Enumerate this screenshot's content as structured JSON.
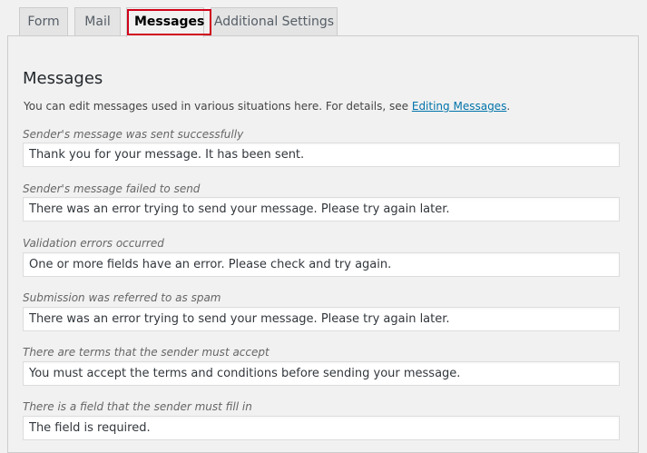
{
  "tabs": [
    {
      "label": "Form",
      "active": false
    },
    {
      "label": "Mail",
      "active": false
    },
    {
      "label": "Messages",
      "active": true
    },
    {
      "label": "Additional Settings",
      "active": false
    }
  ],
  "panel": {
    "title": "Messages",
    "intro_text": "You can edit messages used in various situations here. For details, see ",
    "intro_link": "Editing Messages",
    "intro_end": "."
  },
  "messages": [
    {
      "label": "Sender's message was sent successfully",
      "value": "Thank you for your message. It has been sent."
    },
    {
      "label": "Sender's message failed to send",
      "value": "There was an error trying to send your message. Please try again later."
    },
    {
      "label": "Validation errors occurred",
      "value": "One or more fields have an error. Please check and try again."
    },
    {
      "label": "Submission was referred to as spam",
      "value": "There was an error trying to send your message. Please try again later."
    },
    {
      "label": "There are terms that the sender must accept",
      "value": "You must accept the terms and conditions before sending your message."
    },
    {
      "label": "There is a field that the sender must fill in",
      "value": "The field is required."
    }
  ],
  "colors": {
    "active_tab_highlight": "#d0021b",
    "link": "#0073aa"
  }
}
